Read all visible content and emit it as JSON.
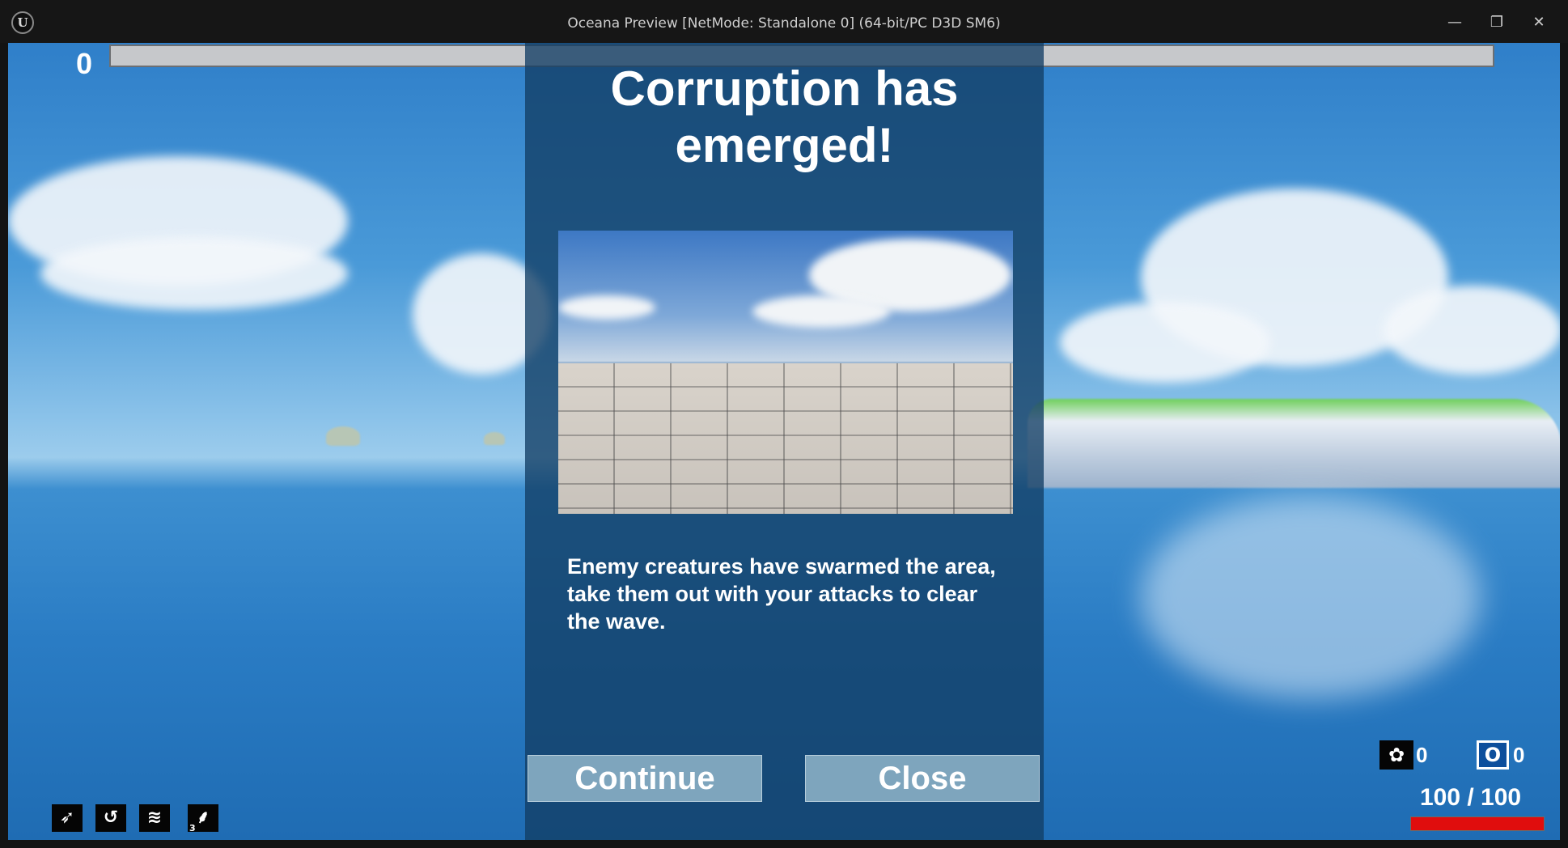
{
  "window": {
    "title": "Oceana Preview [NetMode: Standalone 0]  (64-bit/PC D3D SM6)",
    "logo_text": "U",
    "minimize_glyph": "—",
    "restore_glyph": "❐",
    "close_glyph": "✕"
  },
  "hud": {
    "score": "0",
    "top_bar_progress": 0,
    "abilities": [
      {
        "icon": "dash-icon",
        "glyph": "➶",
        "count": ""
      },
      {
        "icon": "whirl-icon",
        "glyph": "↺",
        "count": ""
      },
      {
        "icon": "wave-icon",
        "glyph": "≋",
        "count": ""
      },
      {
        "icon": "claw-icon",
        "glyph": "⸙",
        "count": "3"
      }
    ],
    "resources": [
      {
        "icon": "pearl-shell-icon",
        "glyph": "✿",
        "value": "0"
      },
      {
        "icon": "ring-icon",
        "glyph": "O",
        "value": "0"
      }
    ],
    "health_text": "100 / 100",
    "health_fraction": 1.0,
    "health_color": "#e00d0d"
  },
  "modal": {
    "heading": "Corruption has emerged!",
    "body": "Enemy creatures have swarmed the area,\ntake them out with your attacks to clear\n the wave.",
    "continue_label": "Continue",
    "close_label": "Close"
  }
}
